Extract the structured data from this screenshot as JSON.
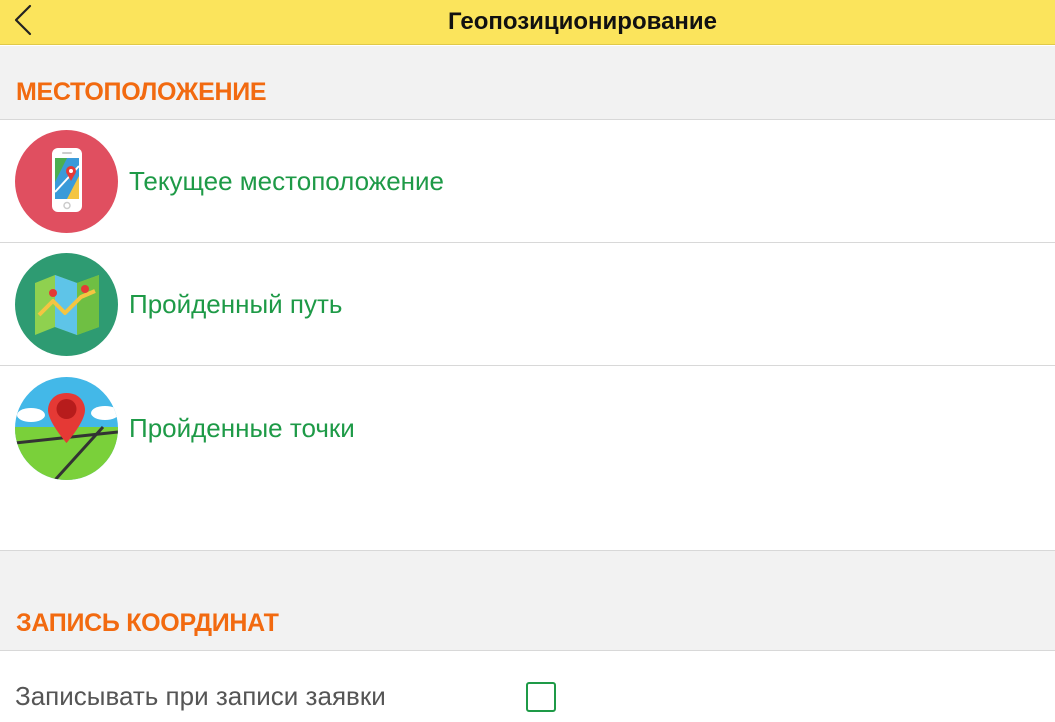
{
  "header": {
    "title": "Геопозиционирование",
    "back_icon": "chevron-left-icon",
    "background": "#fbe45c"
  },
  "sections": [
    {
      "title": "МЕСТОПОЛОЖЕНИЕ",
      "items": [
        {
          "label": "Текущее местоположение",
          "icon": "phone-map-icon"
        },
        {
          "label": "Пройденный путь",
          "icon": "folded-map-icon"
        },
        {
          "label": "Пройденные точки",
          "icon": "map-pin-icon"
        }
      ]
    },
    {
      "title": "ЗАПИСЬ КООРДИНАТ",
      "settings": [
        {
          "label": "Записывать при записи заявки",
          "checked": false
        }
      ]
    }
  ],
  "colors": {
    "section_title": "#f26a10",
    "item_label": "#1e9a47",
    "section_bg": "#f2f2f2"
  }
}
